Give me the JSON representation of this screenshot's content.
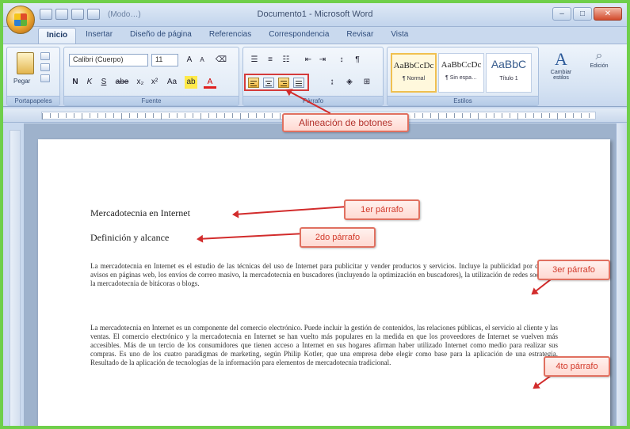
{
  "titlebar": {
    "doc_title": "Documento1 - Microsoft Word",
    "qat_label": "(Modo…)",
    "window_controls": [
      "–",
      "□",
      "✕"
    ]
  },
  "tabs": [
    "Inicio",
    "Insertar",
    "Diseño de página",
    "Referencias",
    "Correspondencia",
    "Revisar",
    "Vista"
  ],
  "ribbon": {
    "clipboard": {
      "paste_label": "Pegar",
      "group_label": "Portapapeles"
    },
    "font": {
      "font_name": "Calibri (Cuerpo)",
      "font_size": "11",
      "group_label": "Fuente",
      "buttons": [
        "N",
        "K",
        "S",
        "abe",
        "x₂",
        "x²",
        "Aa"
      ]
    },
    "paragraph": {
      "group_label": "Párrafo"
    },
    "styles": {
      "group_label": "Estilos",
      "items": [
        {
          "sample": "AaBbCcDc",
          "name": "¶ Normal"
        },
        {
          "sample": "AaBbCcDc",
          "name": "¶ Sin espa…"
        },
        {
          "sample": "AaBbC",
          "name": "Título 1"
        }
      ],
      "change_styles": "Cambiar estilos",
      "editing": "Edición"
    }
  },
  "callouts": {
    "align": "Alineación de botones",
    "p1": "1er párrafo",
    "p2": "2do párrafo",
    "p3": "3er párrafo",
    "p4": "4to párrafo"
  },
  "document": {
    "heading1": "Mercadotecnia en Internet",
    "heading2": "Definición y alcance",
    "para3": "La mercadotecnia en Internet es el estudio de las técnicas del uso de Internet para publicitar y vender productos y servicios. Incluye la publicidad por clic, los avisos en páginas web, los envíos de correo masivo, la mercadotecnia en buscadores (incluyendo la optimización en buscadores), la utilización de redes sociales y la mercadotecnia de bitácoras o blogs.",
    "para4": "La mercadotecnia en Internet es un componente del comercio electrónico. Puede incluir la gestión de contenidos, las relaciones públicas, el servicio al cliente y las ventas. El comercio electrónico y la mercadotecnia en Internet se han vuelto más populares en la medida en que los proveedores de Internet se vuelven más accesibles. Más de un tercio de los consumidores que tienen acceso a Internet en sus hogares afirman haber utilizado Internet como medio para realizar sus compras. Es uno de los cuatro paradigmas de marketing, según Philip Kotler, que una empresa debe elegir como base para la aplicación de una estrategia. Resultado de la aplicación de tecnologías de la información para elementos de mercadotecnia tradicional."
  },
  "colors": {
    "callout_border": "#e07060",
    "callout_text": "#c43a2a",
    "arrow": "#d22c2c",
    "highlight": "#d43b3b",
    "frame_green": "#6fcf4a"
  }
}
